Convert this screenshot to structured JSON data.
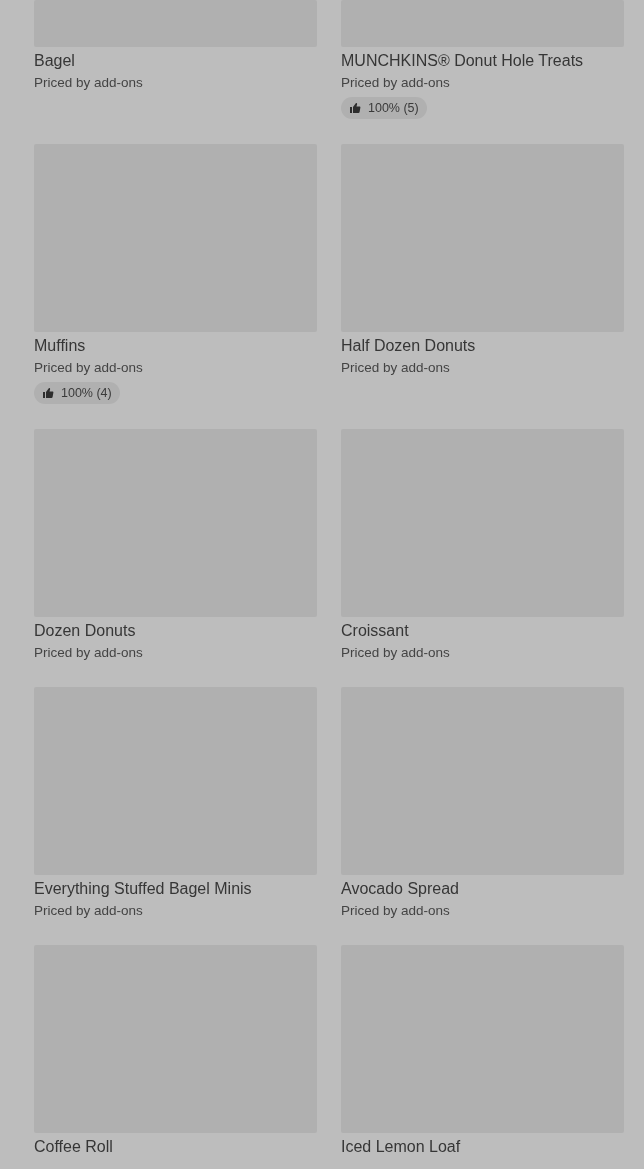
{
  "items": [
    {
      "name": "Bagel",
      "price": "Priced by add-ons"
    },
    {
      "name": "MUNCHKINS® Donut Hole Treats",
      "price": "Priced by add-ons",
      "rating": "100% (5)"
    },
    {
      "name": "Muffins",
      "price": "Priced by add-ons",
      "rating": "100% (4)"
    },
    {
      "name": "Half Dozen Donuts",
      "price": "Priced by add-ons"
    },
    {
      "name": "Dozen Donuts",
      "price": "Priced by add-ons"
    },
    {
      "name": "Croissant",
      "price": "Priced by add-ons"
    },
    {
      "name": "Everything Stuffed Bagel Minis",
      "price": "Priced by add-ons"
    },
    {
      "name": "Avocado Spread",
      "price": "Priced by add-ons"
    },
    {
      "name": "Coffee Roll"
    },
    {
      "name": "Iced Lemon Loaf"
    }
  ]
}
